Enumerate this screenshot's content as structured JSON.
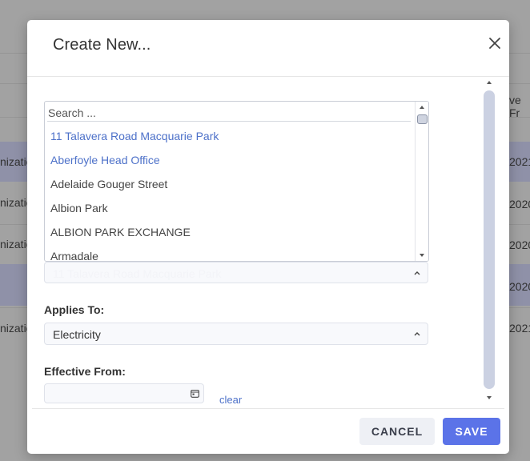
{
  "background": {
    "header_fragment": "ve Fr",
    "rows": [
      {
        "left": "nizatic",
        "right": "2021",
        "selected": true
      },
      {
        "left": "nizatic",
        "right": "2020",
        "selected": false
      },
      {
        "left": "nizatic",
        "right": "2020",
        "selected": false
      },
      {
        "left": "",
        "right": "2020",
        "selected": true
      },
      {
        "left": "nizatic",
        "right": "2021",
        "selected": false
      }
    ]
  },
  "modal": {
    "title": "Create New...",
    "close_icon": "close-icon",
    "location": {
      "selected_value": "11 Talavera Road Macquarie Park",
      "search_placeholder": "Search ...",
      "options": [
        {
          "label": "11 Talavera Road Macquarie Park",
          "highlighted": true
        },
        {
          "label": "Aberfoyle Head Office",
          "highlighted": true
        },
        {
          "label": "Adelaide Gouger Street",
          "highlighted": false
        },
        {
          "label": "Albion Park",
          "highlighted": false
        },
        {
          "label": "ALBION PARK EXCHANGE",
          "highlighted": false
        },
        {
          "label": "Armadale",
          "highlighted": false
        }
      ]
    },
    "applies_to": {
      "label": "Applies To:",
      "value": "Electricity"
    },
    "effective_from": {
      "label": "Effective From:",
      "value": "",
      "clear_label": "clear"
    },
    "buttons": {
      "cancel": "CANCEL",
      "save": "SAVE"
    },
    "colors": {
      "accent": "#5b73e8",
      "link": "#4d71c9",
      "scroll_thumb": "#cbd1e2"
    }
  }
}
